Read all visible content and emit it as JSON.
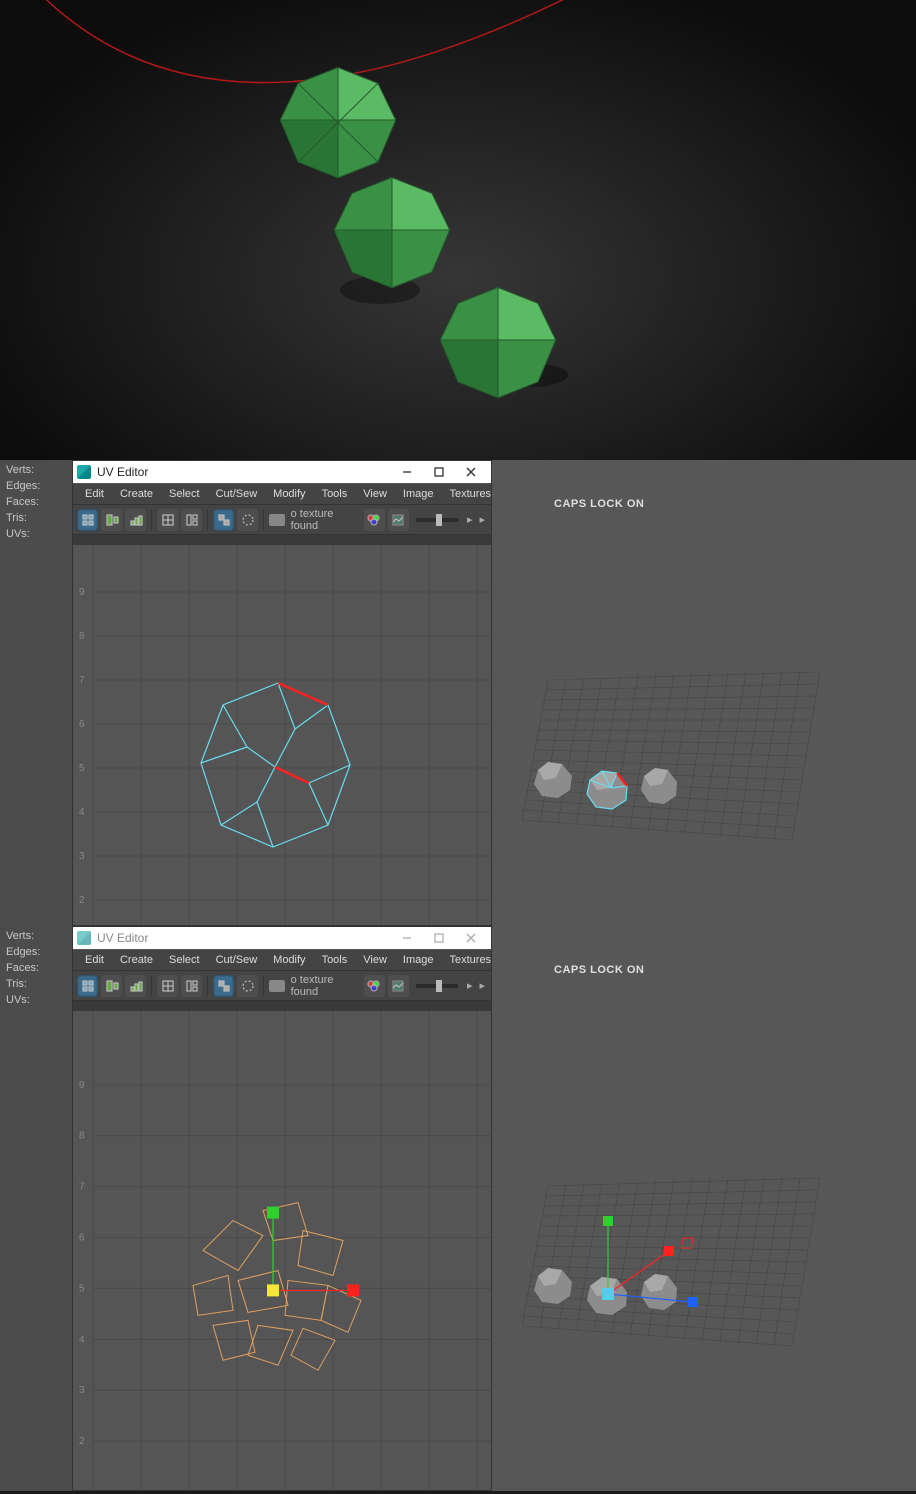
{
  "top_viewport": {
    "object_color": "#3a9146"
  },
  "stats": {
    "verts": "Verts:",
    "edges": "Edges:",
    "faces": "Faces:",
    "tris": "Tris:",
    "uvs": "UVs:"
  },
  "uv_editor": {
    "title": "UV Editor",
    "menus": [
      "Edit",
      "Create",
      "Select",
      "Cut/Sew",
      "Modify",
      "Tools",
      "View",
      "Image",
      "Textures"
    ],
    "texture_msg": "o texture found",
    "grid_labels": [
      "2",
      "3",
      "4",
      "5",
      "6",
      "7",
      "8",
      "9"
    ]
  },
  "right_viewport": {
    "caps_msg": "CAPS LOCK ON"
  }
}
